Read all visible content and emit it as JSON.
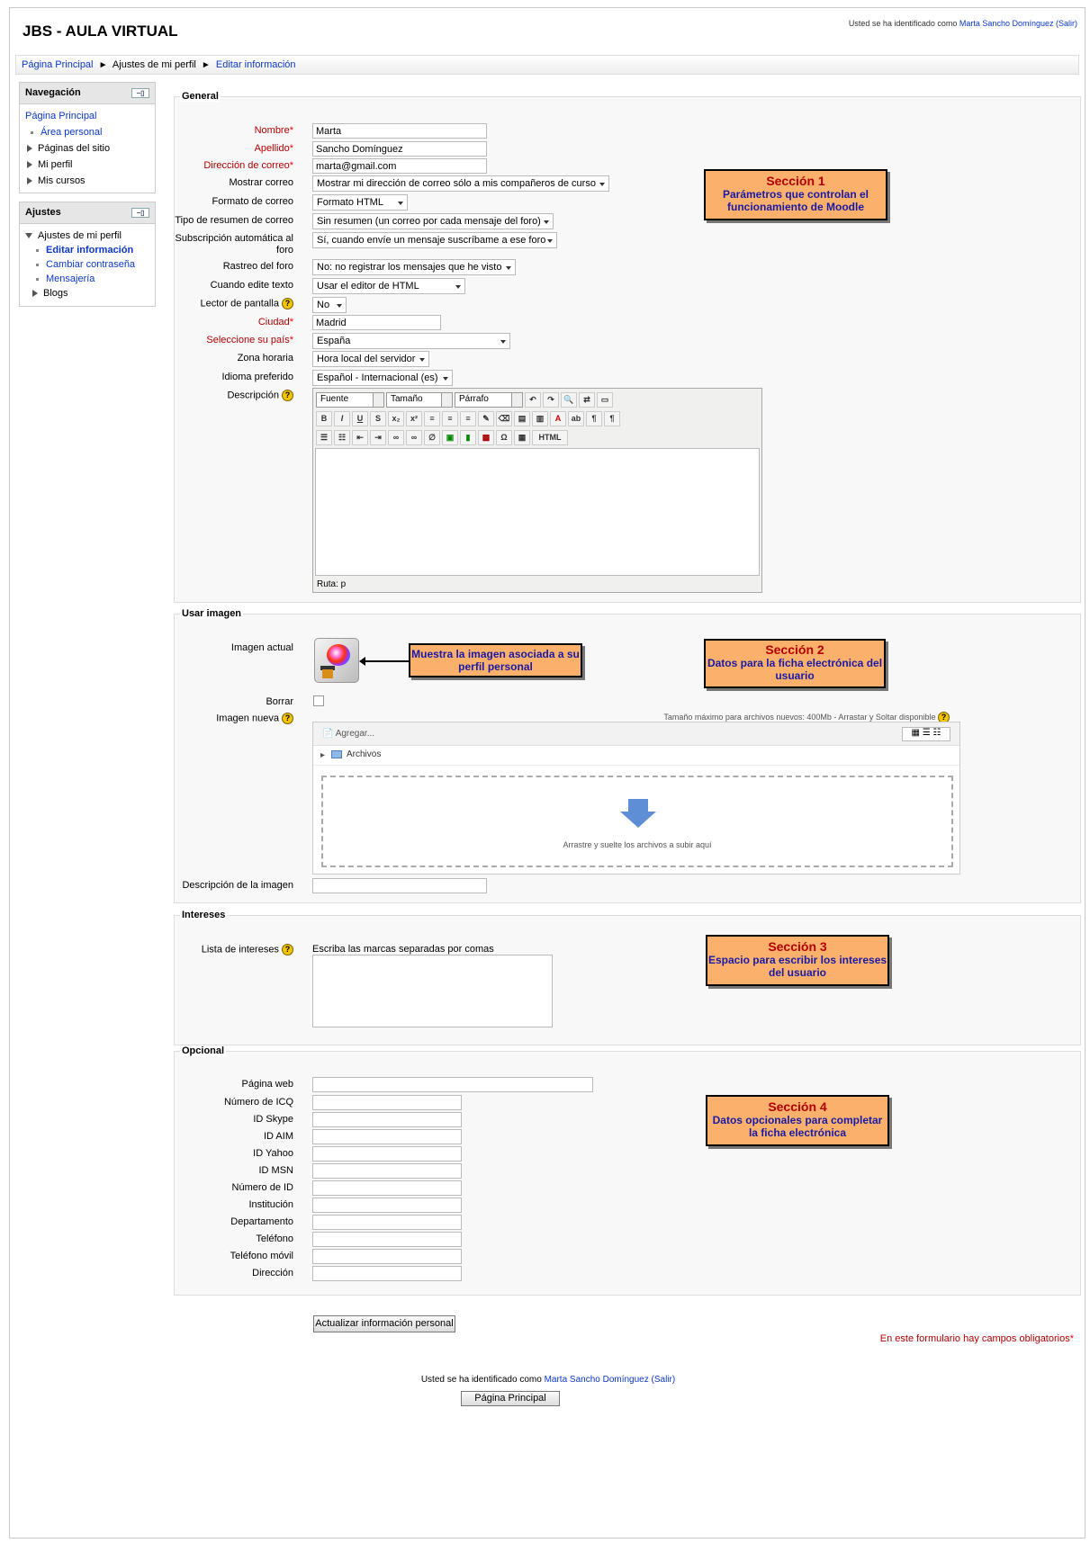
{
  "header": {
    "site_title": "JBS - AULA VIRTUAL",
    "login_prefix": "Usted se ha identificado como ",
    "user_name": "Marta Sancho Domínguez",
    "logout": "(Salir)"
  },
  "breadcrumb": {
    "home": "Página Principal",
    "sep": "►",
    "profile_settings": "Ajustes de mi perfil",
    "current": "Editar información"
  },
  "nav_block": {
    "title": "Navegación",
    "home": "Página Principal",
    "items": [
      "Área personal",
      "Páginas del sitio",
      "Mi perfil",
      "Mis cursos"
    ]
  },
  "settings_block": {
    "title": "Ajustes",
    "group": "Ajustes de mi perfil",
    "items": [
      "Editar información",
      "Cambiar contraseña",
      "Mensajería"
    ],
    "blogs": "Blogs"
  },
  "general": {
    "legend": "General",
    "nombre_label": "Nombre",
    "nombre": "Marta",
    "apellido_label": "Apellido",
    "apellido": "Sancho Domínguez",
    "email_label": "Dirección de correo",
    "email": "marta@gmail.com",
    "mostrar_label": "Mostrar correo",
    "mostrar": "Mostrar mi dirección de correo sólo a mis compañeros de curso",
    "formato_label": "Formato de correo",
    "formato": "Formato HTML",
    "resumen_label": "Tipo de resumen de correo",
    "resumen": "Sin resumen (un correo por cada mensaje del foro)",
    "subs_label_1": "Subscripción automática al",
    "subs_label_2": "foro",
    "subs": "Sí, cuando envíe un mensaje suscríbame a ese foro",
    "rastreo_label": "Rastreo del foro",
    "rastreo": "No: no registrar los mensajes que he visto",
    "editor_label": "Cuando edite texto",
    "editor": "Usar el editor de HTML",
    "lector_label": "Lector de pantalla",
    "lector": "No",
    "ciudad_label": "Ciudad",
    "ciudad": "Madrid",
    "pais_label": "Seleccione su país",
    "pais": "España",
    "zona_label": "Zona horaria",
    "zona": "Hora local del servidor",
    "idioma_label": "Idioma preferido",
    "idioma": "Español - Internacional (es)",
    "desc_label": "Descripción",
    "ed_font": "Fuente",
    "ed_size": "Tamaño",
    "ed_format": "Párrafo",
    "ed_path": "Ruta: p"
  },
  "callouts": {
    "s1_title": "Sección 1",
    "s1_text": "Parámetros que controlan el funcionamiento de Moodle",
    "s2_title": "Sección 2",
    "s2_text": "Datos para la ficha electrónica del usuario",
    "s2_arrow": "Muestra la imagen asociada a su perfil personal",
    "s3_title": "Sección 3",
    "s3_text": "Espacio para escribir los intereses del usuario",
    "s4_title": "Sección 4",
    "s4_text": "Datos opcionales para completar la ficha electrónica"
  },
  "imagen": {
    "legend": "Usar imagen",
    "actual_label": "Imagen actual",
    "borrar_label": "Borrar",
    "nueva_label": "Imagen nueva",
    "max_size": "Tamaño máximo para archivos nuevos: 400Mb - Arrastar y Soltar disponible",
    "add": "Agregar...",
    "folder": "Archivos",
    "drop_text": "Arrastre y suelte los archivos a subir aquí",
    "desc_label": "Descripción de la imagen"
  },
  "intereses": {
    "legend": "Intereses",
    "label": "Lista de intereses",
    "hint": "Escriba las marcas separadas por comas"
  },
  "opcional": {
    "legend": "Opcional",
    "fields": [
      "Página web",
      "Número de ICQ",
      "ID Skype",
      "ID AIM",
      "ID Yahoo",
      "ID MSN",
      "Número de ID",
      "Institución",
      "Departamento",
      "Teléfono",
      "Teléfono móvil",
      "Dirección"
    ]
  },
  "submit": "Actualizar información personal",
  "required_note": "En este formulario hay campos obligatorios",
  "footer": {
    "login_prefix": "Usted se ha identificado como ",
    "user_name": "Marta Sancho Domínguez",
    "logout": "(Salir)",
    "home_button": "Página Principal"
  }
}
